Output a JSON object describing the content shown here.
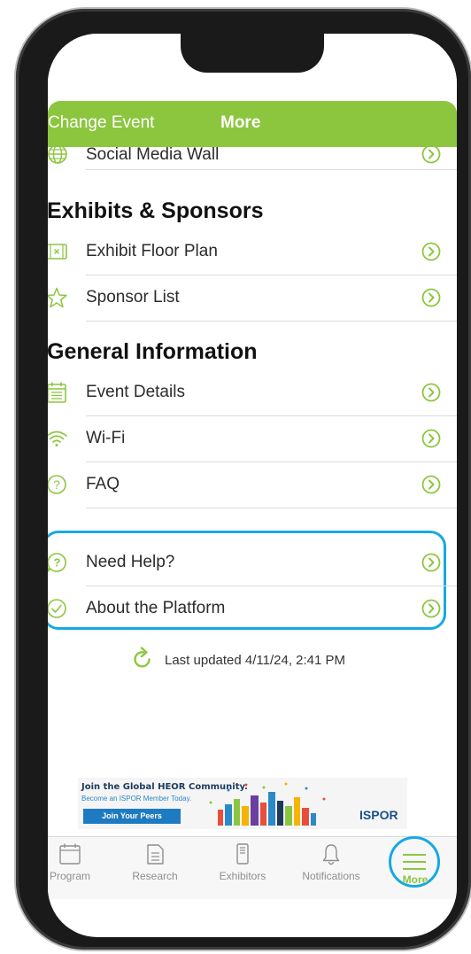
{
  "header": {
    "change_event": "Change Event",
    "title": "More"
  },
  "colors": {
    "brand_green": "#8cc63f",
    "highlight_blue": "#17a9e1"
  },
  "top_item": {
    "label": "Social Media Wall",
    "icon": "globe-icon"
  },
  "sections": [
    {
      "title": "Exhibits & Sponsors",
      "items": [
        {
          "label": "Exhibit Floor Plan",
          "icon": "floor-plan-icon"
        },
        {
          "label": "Sponsor List",
          "icon": "star-icon"
        }
      ]
    },
    {
      "title": "General Information",
      "items": [
        {
          "label": "Event Details",
          "icon": "calendar-icon"
        },
        {
          "label": "Wi-Fi",
          "icon": "wifi-icon"
        },
        {
          "label": "FAQ",
          "icon": "question-icon"
        }
      ]
    }
  ],
  "help_items": [
    {
      "label": "Need Help?",
      "icon": "help-bubble-icon"
    },
    {
      "label": "About the Platform",
      "icon": "check-circle-icon"
    }
  ],
  "last_updated": "Last updated 4/11/24, 2:41 PM",
  "banner": {
    "headline": "Join the Global HEOR Community.",
    "subline": "Become an ISPOR Member Today.",
    "button": "Join Your Peers",
    "logo": "ISPOR"
  },
  "tabbar": {
    "tabs": [
      {
        "label": "Program",
        "icon": "calendar-icon"
      },
      {
        "label": "Research",
        "icon": "document-icon"
      },
      {
        "label": "Exhibitors",
        "icon": "booth-icon"
      },
      {
        "label": "Notifications",
        "icon": "bell-icon"
      }
    ],
    "more_label": "More"
  }
}
